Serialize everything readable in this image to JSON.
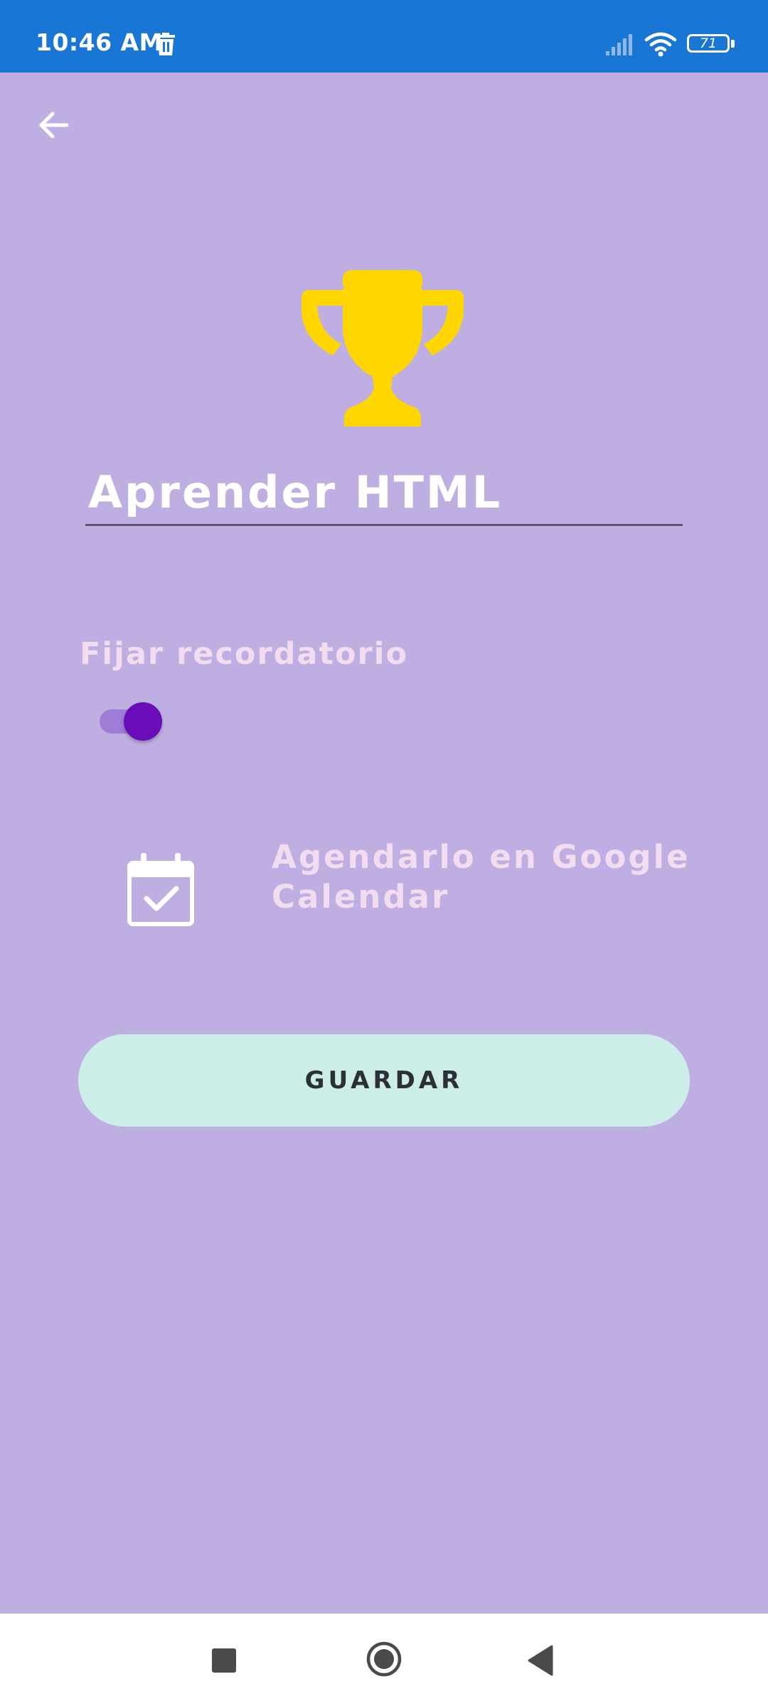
{
  "status_bar": {
    "time": "10:46 AM",
    "battery_level": "71",
    "icons": [
      "trash-icon",
      "signal-icon",
      "wifi-icon",
      "battery-icon"
    ]
  },
  "header": {
    "back_icon": "arrow-left-icon"
  },
  "goal": {
    "icon": "trophy-icon",
    "title": "Aprender HTML"
  },
  "reminder": {
    "label": "Fijar recordatorio",
    "enabled": true
  },
  "calendar": {
    "icon": "calendar-check-icon",
    "label": "Agendarlo en Google Calendar"
  },
  "actions": {
    "save_label": "GUARDAR"
  },
  "nav_bar": {
    "icons": [
      "recents-icon",
      "home-icon",
      "back-icon"
    ]
  },
  "colors": {
    "background": "#BFAEE1",
    "status_bar": "#1976D5",
    "trophy": "#FFD600",
    "toggle_thumb": "#6A0DB8",
    "toggle_track": "#9F7CD6",
    "pink_text": "#F3DCEF",
    "save_button": "#CDEEE8"
  }
}
